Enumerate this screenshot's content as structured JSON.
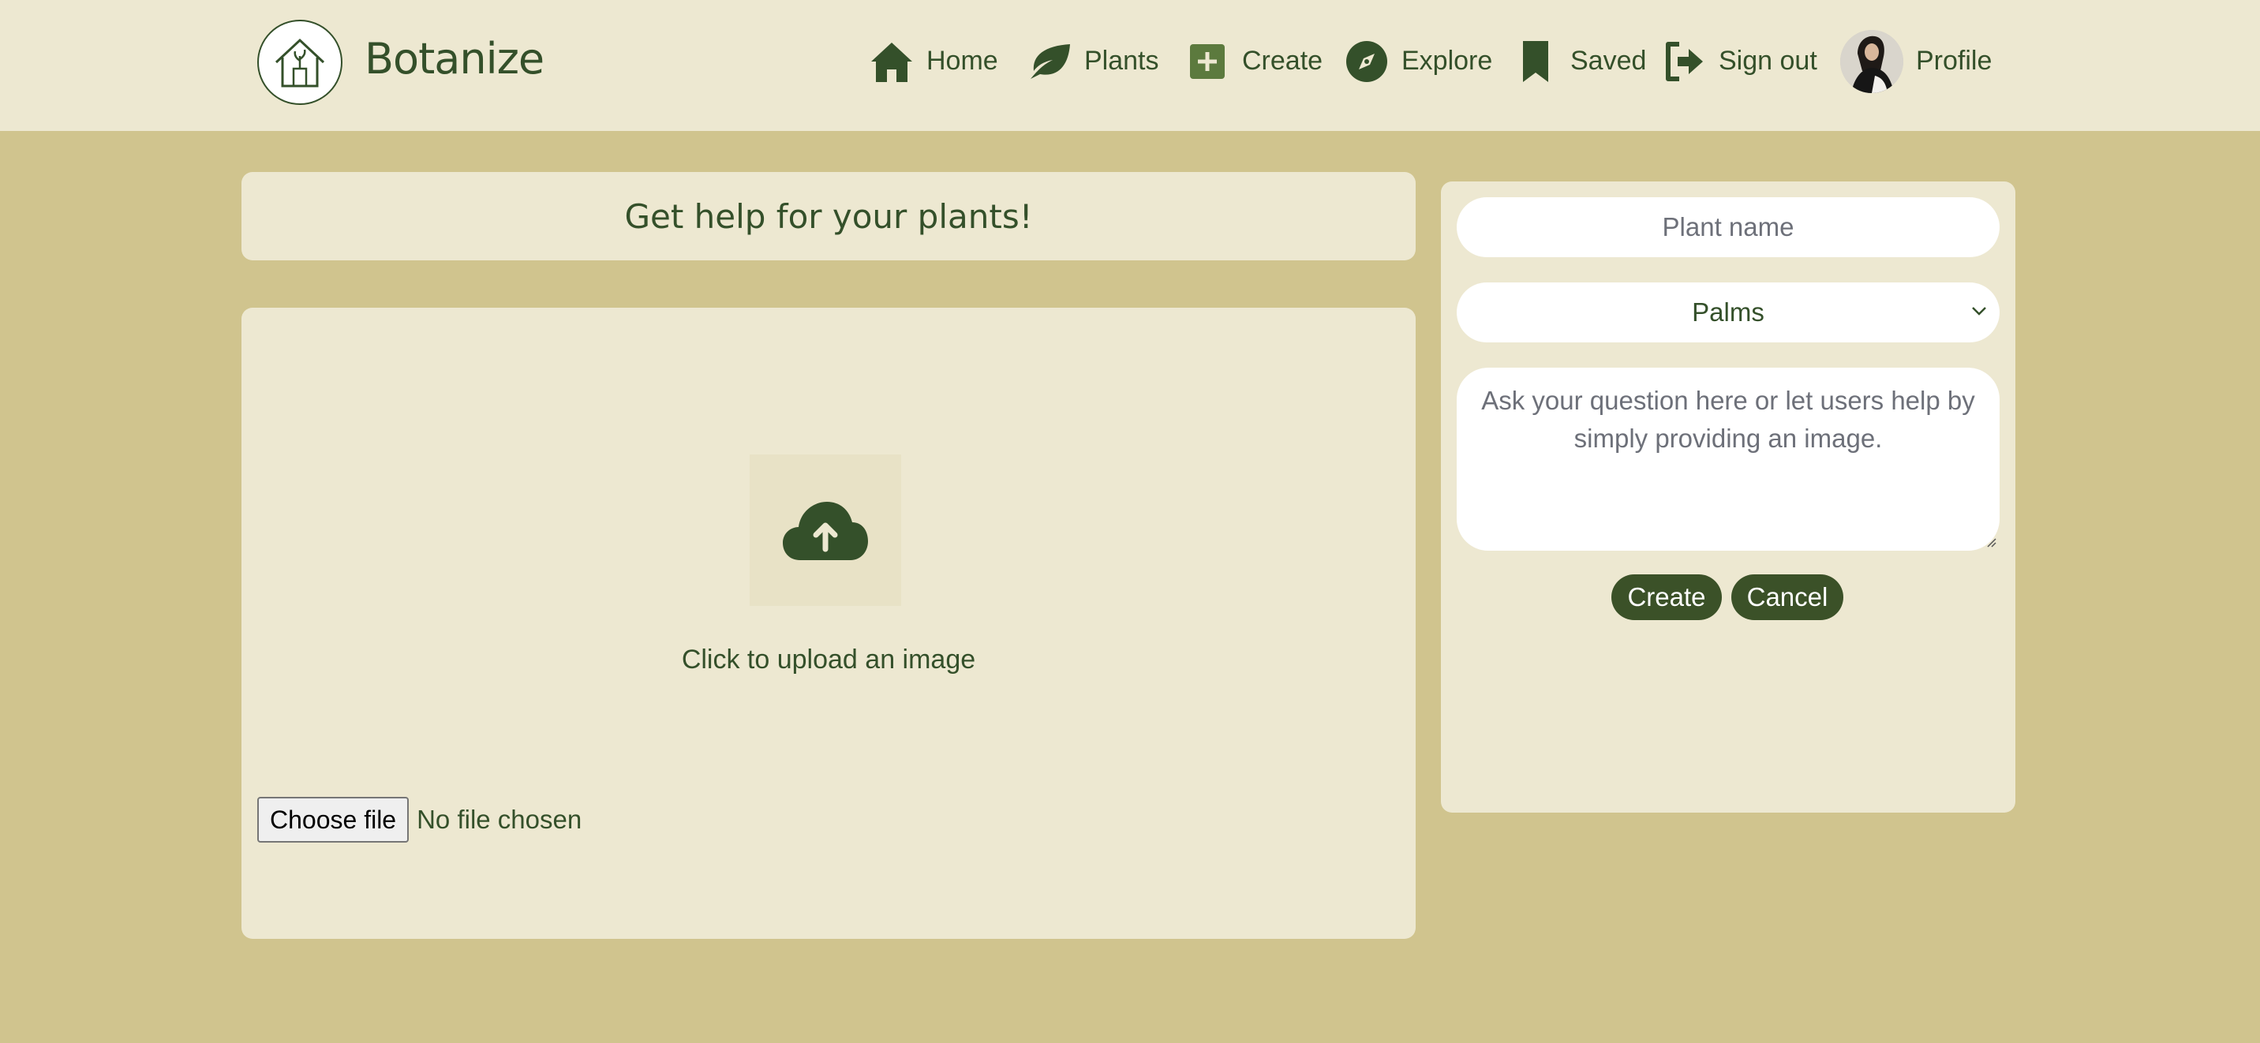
{
  "header": {
    "brand": "Botanize",
    "nav": [
      {
        "label": "Home",
        "icon": "home-icon"
      },
      {
        "label": "Plants",
        "icon": "leaf-icon"
      },
      {
        "label": "Create",
        "icon": "plus-square-icon"
      },
      {
        "label": "Explore",
        "icon": "compass-icon"
      },
      {
        "label": "Saved",
        "icon": "bookmark-icon"
      },
      {
        "label": "Sign out",
        "icon": "sign-out-icon"
      },
      {
        "label": "Profile",
        "icon": "avatar"
      }
    ]
  },
  "main": {
    "title": "Get help for your plants!",
    "upload": {
      "label": "Click to upload an image",
      "choose_button": "Choose file",
      "file_status": "No file chosen"
    }
  },
  "form": {
    "plant_name_placeholder": "Plant name",
    "category_selected": "Palms",
    "question_placeholder": "Ask your question here or let users help by simply providing an image.",
    "create_button": "Create",
    "cancel_button": "Cancel"
  },
  "colors": {
    "page_bg": "#d0c48e",
    "panel_bg": "#ede8d1",
    "accent": "#34502a",
    "button_bg": "#3b5128"
  }
}
